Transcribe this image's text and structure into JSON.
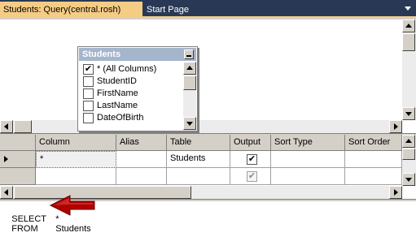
{
  "tabs": {
    "active": "Students: Query(central.rosh)",
    "other": "Start Page"
  },
  "diagram": {
    "table_title": "Students",
    "columns": [
      {
        "label": "* (All Columns)",
        "checked": true
      },
      {
        "label": "StudentID",
        "checked": false
      },
      {
        "label": "FirstName",
        "checked": false
      },
      {
        "label": "LastName",
        "checked": false
      },
      {
        "label": "DateOfBirth",
        "checked": false
      }
    ]
  },
  "grid": {
    "headers": [
      "Column",
      "Alias",
      "Table",
      "Output",
      "Sort Type",
      "Sort Order"
    ],
    "rows": [
      {
        "column": "*",
        "alias": "",
        "table": "Students",
        "output": true
      },
      {
        "column": "",
        "alias": "",
        "table": "",
        "output": true
      }
    ]
  },
  "sql": {
    "select_kw": "SELECT",
    "select_val": "*",
    "from_kw": "FROM",
    "from_val": "Students"
  },
  "colors": {
    "tab_strip": "#293955",
    "active_tab": "#f5cc84",
    "table_header": "#a5b5cc",
    "annotation_arrow": "#b00000"
  }
}
